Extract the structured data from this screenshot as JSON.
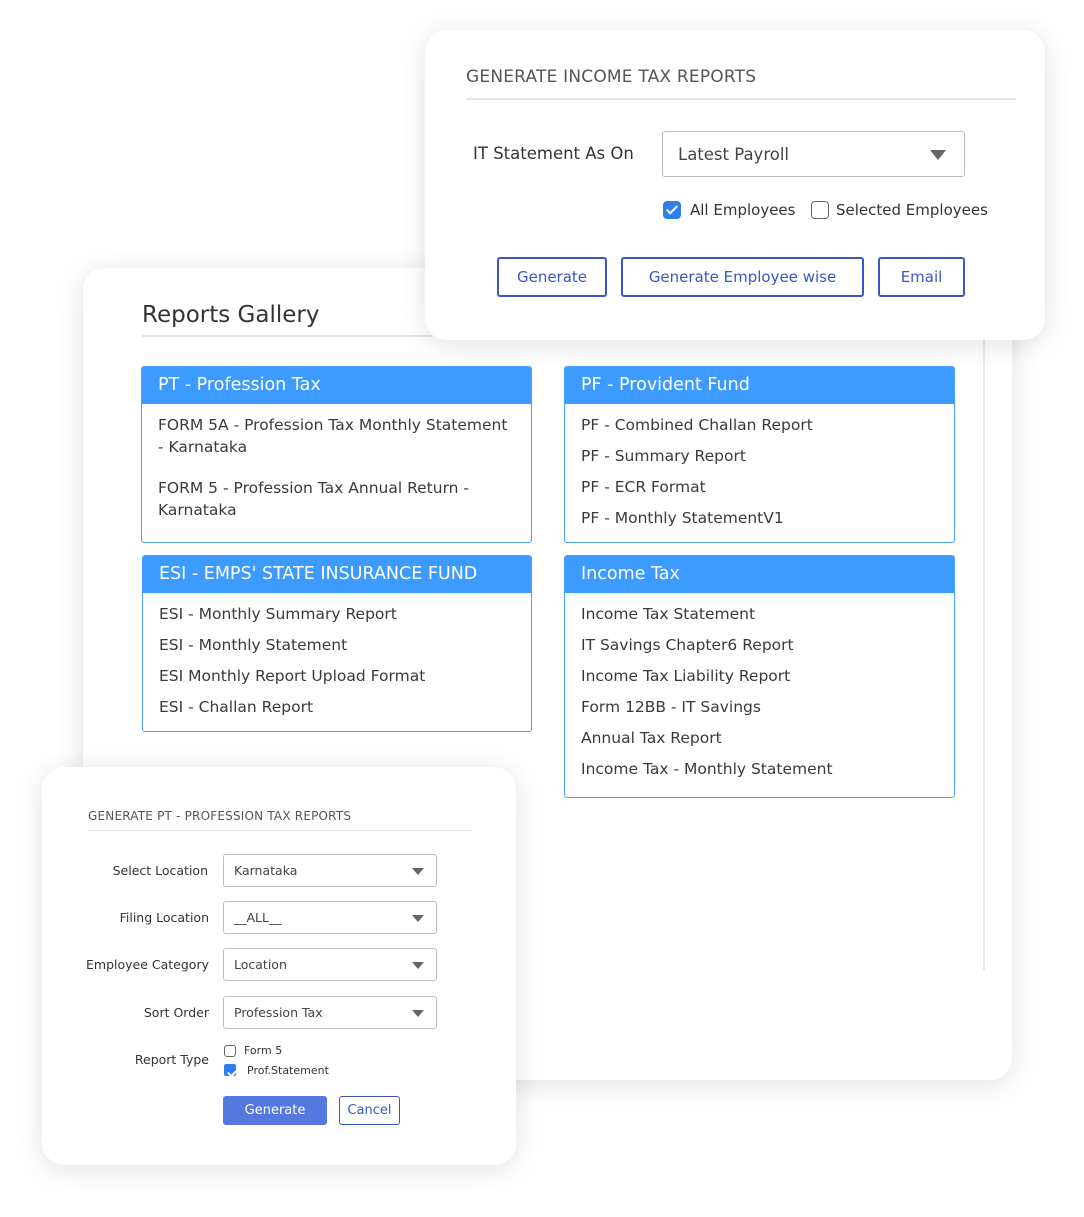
{
  "gallery": {
    "title": "Reports Gallery",
    "sections": [
      {
        "title": "PT - Profession Tax",
        "items": [
          "FORM 5A - Profession Tax Monthly Statement - Karnataka",
          "FORM 5 - Profession Tax Annual Return - Karnataka"
        ]
      },
      {
        "title": "PF - Provident Fund",
        "items": [
          "PF - Combined Challan Report",
          "PF - Summary Report",
          "PF - ECR Format",
          "PF - Monthly StatementV1"
        ]
      },
      {
        "title": "ESI - EMPS' STATE INSURANCE FUND",
        "items": [
          "ESI - Monthly Summary Report",
          "ESI - Monthly Statement",
          "ESI Monthly Report Upload Format",
          "ESI - Challan Report"
        ]
      },
      {
        "title": "Income Tax",
        "items": [
          "Income Tax Statement",
          "IT Savings Chapter6 Report",
          "Income Tax Liability Report",
          "Form 12BB - IT Savings",
          "Annual Tax Report",
          "Income Tax - Monthly Statement"
        ]
      }
    ]
  },
  "it_panel": {
    "title": "GENERATE INCOME TAX REPORTS",
    "statement_label": "IT Statement As On",
    "statement_value": "Latest Payroll",
    "all_employees": {
      "label": "All Employees",
      "checked": true
    },
    "selected_employees": {
      "label": "Selected Employees",
      "checked": false
    },
    "buttons": {
      "generate": "Generate",
      "generate_employee_wise": "Generate Employee wise",
      "email": "Email"
    }
  },
  "pt_panel": {
    "title": "GENERATE PT - PROFESSION TAX REPORTS",
    "fields": [
      {
        "label": "Select Location",
        "value": "Karnataka"
      },
      {
        "label": "Filing Location",
        "value": "__ALL__"
      },
      {
        "label": "Employee Category",
        "value": "Location"
      },
      {
        "label": "Sort Order",
        "value": "Profession Tax"
      }
    ],
    "report_type_label": "Report Type",
    "report_types": [
      {
        "label": "Form 5",
        "checked": false
      },
      {
        "label": "Prof.Statement",
        "checked": true
      }
    ],
    "buttons": {
      "generate": "Generate",
      "cancel": "Cancel"
    }
  },
  "colors": {
    "header_blue": "#3d9bff",
    "button_blue": "#3a55c4",
    "primary_fill": "#5577e0",
    "checkbox_blue": "#2f7ff0"
  }
}
